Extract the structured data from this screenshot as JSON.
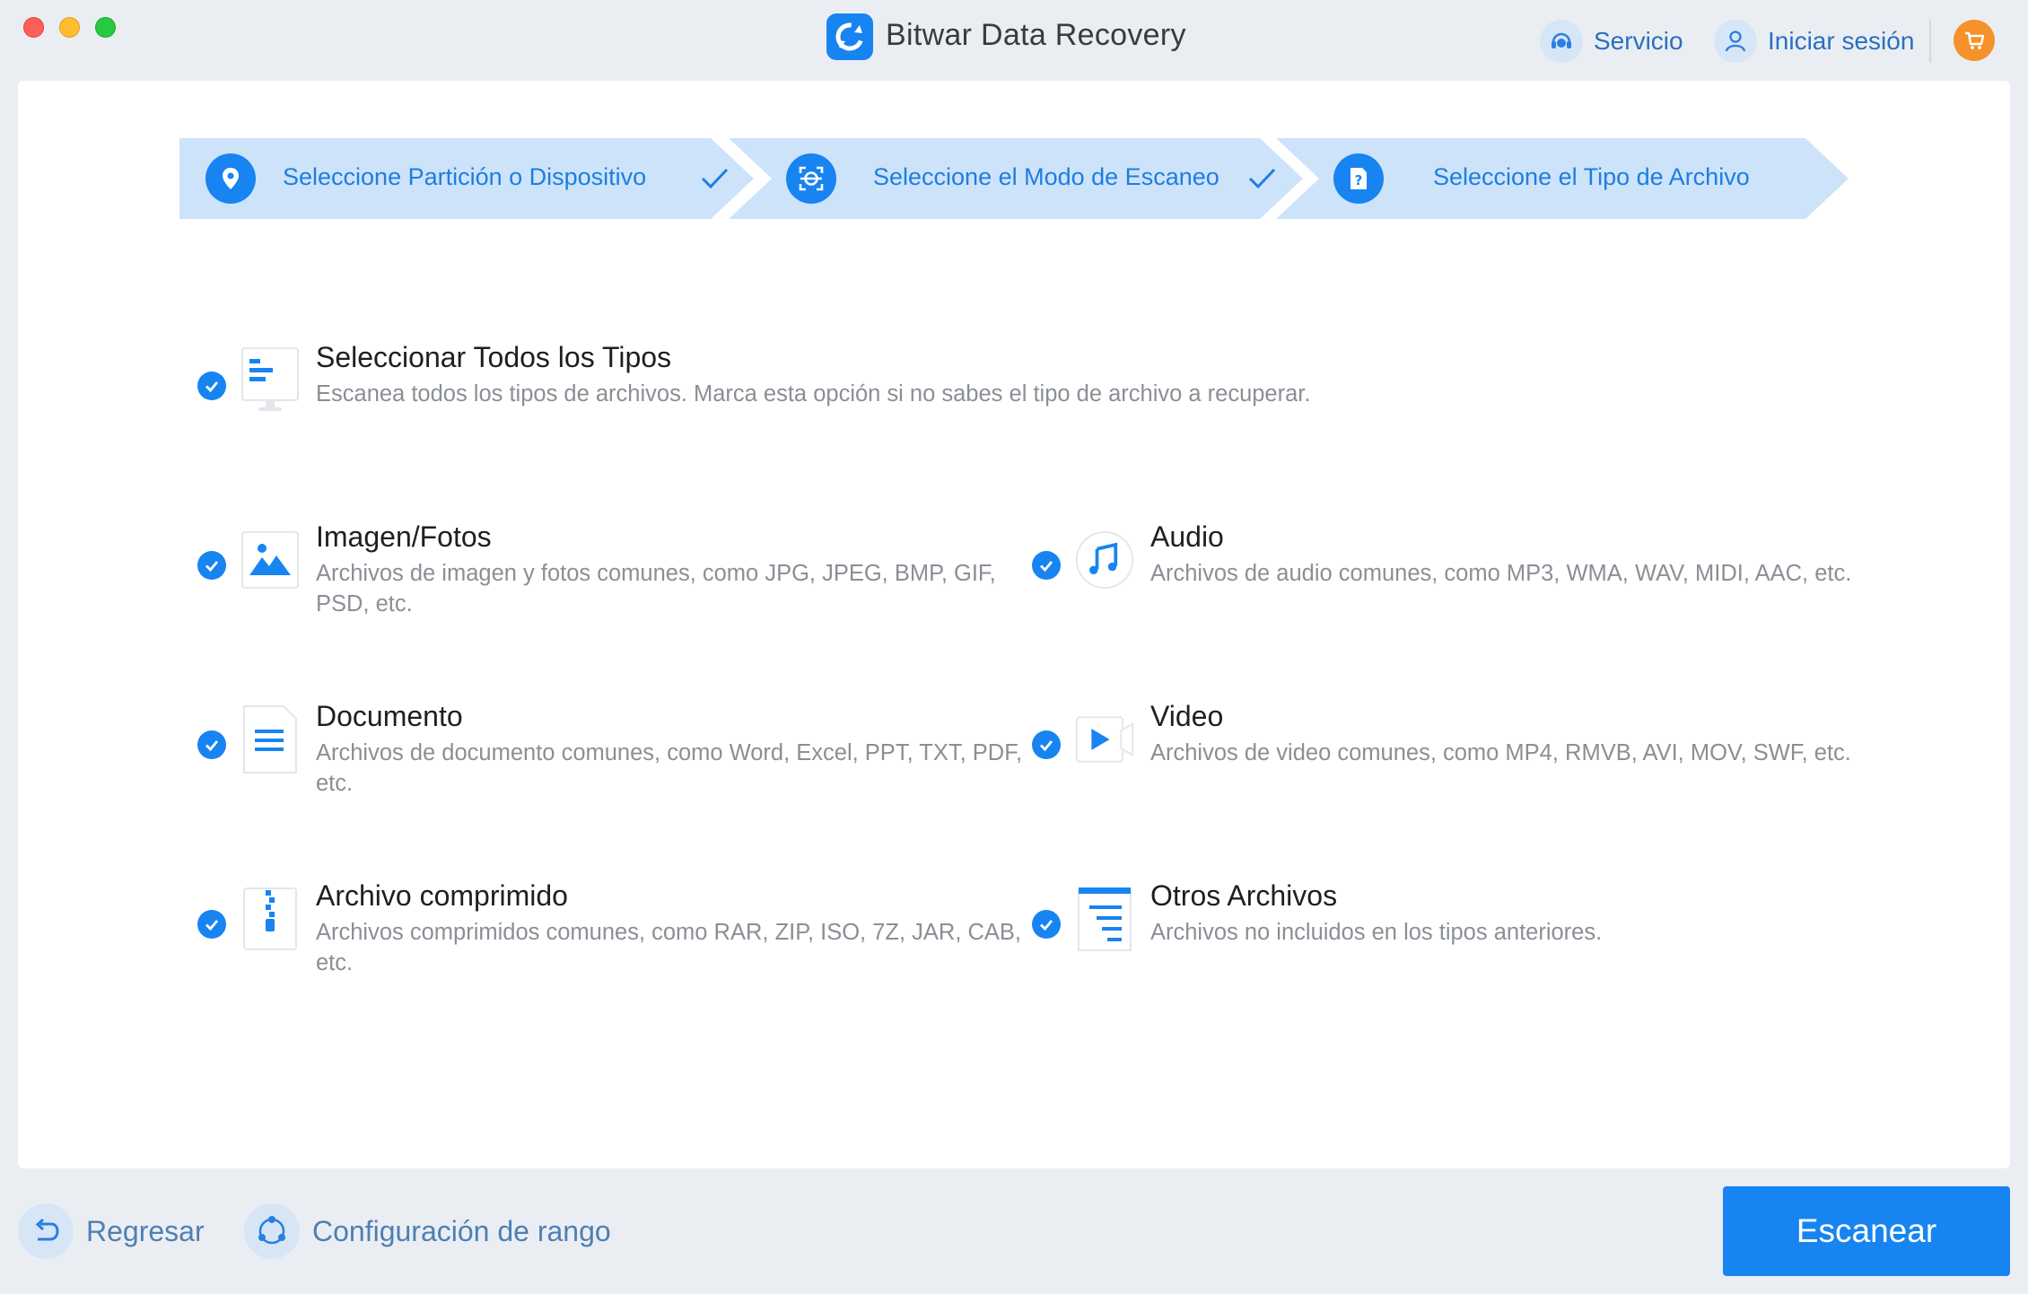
{
  "app": {
    "title": "Bitwar Data Recovery"
  },
  "header": {
    "service_label": "Servicio",
    "login_label": "Iniciar sesión"
  },
  "steps": [
    {
      "label": "Seleccione Partición o Dispositivo",
      "completed": true
    },
    {
      "label": "Seleccione el Modo de Escaneo",
      "completed": true
    },
    {
      "label": "Seleccione el Tipo de Archivo",
      "completed": false
    }
  ],
  "file_types": {
    "all": {
      "title": "Seleccionar Todos los Tipos",
      "desc": "Escanea todos los tipos de archivos. Marca esta opción si no sabes el tipo de archivo a recuperar.",
      "checked": true,
      "icon": "all-types-icon"
    },
    "image": {
      "title": "Imagen/Fotos",
      "desc": "Archivos de imagen y fotos comunes, como JPG, JPEG, BMP, GIF, PSD, etc.",
      "checked": true,
      "icon": "image-icon"
    },
    "audio": {
      "title": "Audio",
      "desc": "Archivos de audio comunes, como MP3, WMA, WAV, MIDI, AAC, etc.",
      "checked": true,
      "icon": "music-note-icon"
    },
    "document": {
      "title": "Documento",
      "desc": "Archivos de documento comunes, como Word, Excel, PPT, TXT, PDF, etc.",
      "checked": true,
      "icon": "document-icon"
    },
    "video": {
      "title": "Video",
      "desc": "Archivos de video comunes, como MP4, RMVB, AVI, MOV, SWF, etc.",
      "checked": true,
      "icon": "video-play-icon"
    },
    "archive": {
      "title": "Archivo comprimido",
      "desc": "Archivos comprimidos comunes, como RAR, ZIP, ISO, 7Z, JAR, CAB, etc.",
      "checked": true,
      "icon": "zip-icon"
    },
    "other": {
      "title": "Otros Archivos",
      "desc": "Archivos no incluidos en los tipos anteriores.",
      "checked": true,
      "icon": "other-files-icon"
    }
  },
  "footer": {
    "back_label": "Regresar",
    "range_label": "Configuración de rango",
    "scan_label": "Escanear"
  },
  "colors": {
    "accent": "#1784f1",
    "step_bg": "#cde3fa",
    "cart": "#f5922b",
    "background": "#eaeef3"
  }
}
